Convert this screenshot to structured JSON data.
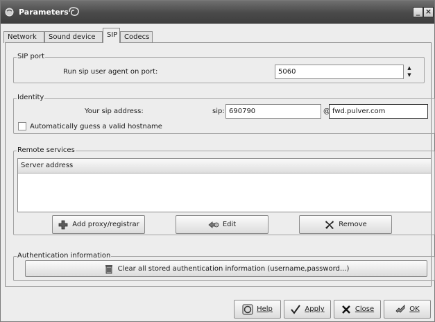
{
  "window": {
    "title": "Parameters"
  },
  "tabs": [
    {
      "label": "Network",
      "active": false
    },
    {
      "label": "Sound device",
      "active": false
    },
    {
      "label": "SIP",
      "active": true
    },
    {
      "label": "Codecs",
      "active": false
    }
  ],
  "sip_port": {
    "title": "SIP port",
    "label": "Run sip user agent on port:",
    "value": "5060"
  },
  "identity": {
    "title": "Identity",
    "address_label": "Your sip address:",
    "prefix": "sip:",
    "user": "690790",
    "at": "@",
    "domain": "fwd.pulver.com",
    "auto_hostname_label": "Automatically guess a valid hostname",
    "auto_hostname_checked": false
  },
  "remote_services": {
    "title": "Remote services",
    "column_header": "Server address",
    "rows": [],
    "add_label": "Add proxy/registrar",
    "edit_label": "Edit",
    "remove_label": "Remove"
  },
  "authentication": {
    "title": "Authentication information",
    "clear_label": "Clear all stored authentication information (username,password...)"
  },
  "footer": {
    "help_label": "Help",
    "apply_label": "Apply",
    "close_label": "Close",
    "ok_label": "OK"
  },
  "icons": {
    "app": "phone-icon",
    "add": "plus-icon",
    "edit": "edit-icon",
    "remove": "x-icon",
    "clear": "trash-icon",
    "help": "help-icon",
    "apply": "check-icon",
    "close": "close-icon",
    "ok": "ok-icon"
  }
}
